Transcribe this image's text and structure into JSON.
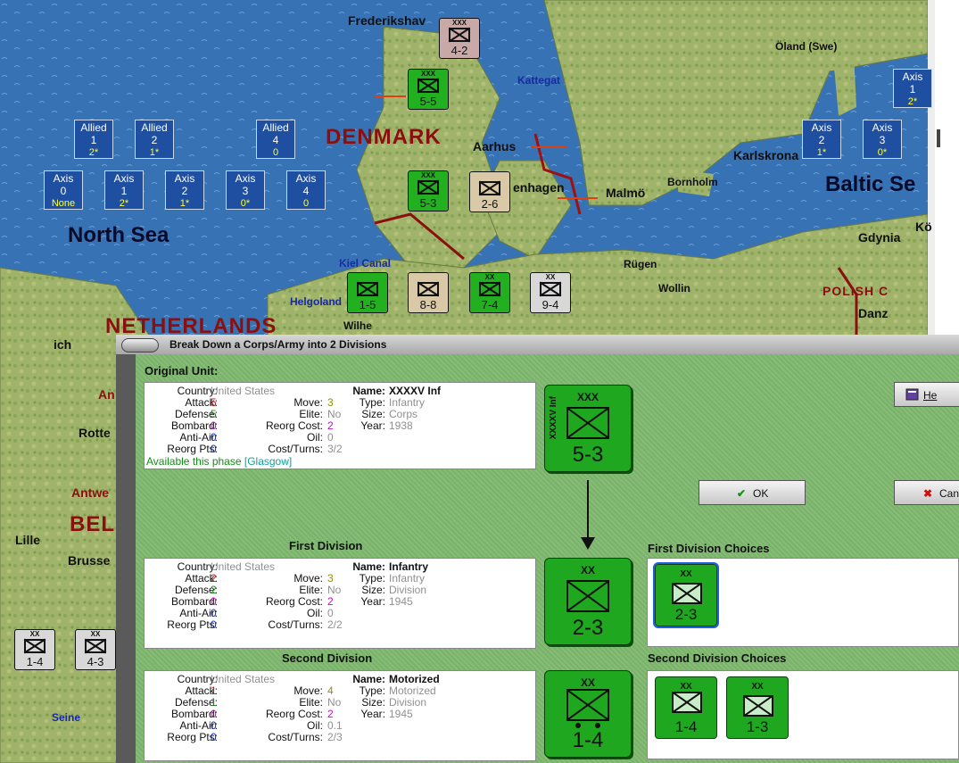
{
  "map": {
    "countries": [
      "DENMARK",
      "NETHERLANDS",
      "BEL",
      "POLISH C"
    ],
    "seas": [
      "North Sea",
      "Baltic Se"
    ],
    "sea_labels": [
      "Kattegat",
      "Helgoland",
      "Kiel Canal"
    ],
    "cities": [
      "Frederikshav",
      "Aarhus",
      "enhagen",
      "Malmö",
      "Karlskrona",
      "Bornholm",
      "Öland (Swe)",
      "Gdynia",
      "Rügen",
      "Wollin",
      "Danz",
      "Lille",
      "Brusse",
      "Rotte",
      "Antwe",
      "An",
      "ich",
      "Wilhe",
      "Seine",
      "Kö"
    ],
    "allied_reserve": [
      {
        "label": "Allied",
        "num": "1",
        "sub": "2*"
      },
      {
        "label": "Allied",
        "num": "2",
        "sub": "1*"
      },
      {
        "label": "Allied",
        "num": "4",
        "sub": "0"
      }
    ],
    "axis_reserve": [
      {
        "label": "Axis",
        "num": "0",
        "sub": "None"
      },
      {
        "label": "Axis",
        "num": "1",
        "sub": "2*"
      },
      {
        "label": "Axis",
        "num": "2",
        "sub": "1*"
      },
      {
        "label": "Axis",
        "num": "3",
        "sub": "0*"
      },
      {
        "label": "Axis",
        "num": "4",
        "sub": "0"
      }
    ],
    "axis_reserve_east": [
      {
        "label": "Axis",
        "num": "1",
        "sub": "2*"
      },
      {
        "label": "Axis",
        "num": "2",
        "sub": "1*"
      },
      {
        "label": "Axis",
        "num": "3",
        "sub": "0*"
      }
    ],
    "map_units": [
      {
        "size": "XXX",
        "str": "4-2",
        "style": "r"
      },
      {
        "size": "XXX",
        "str": "5-5",
        "style": "g"
      },
      {
        "size": "XXX",
        "str": "5-3",
        "style": "g"
      },
      {
        "size": "",
        "str": "2-6",
        "style": "t"
      },
      {
        "size": "",
        "str": "1-5",
        "style": "g"
      },
      {
        "size": "",
        "str": "8-8",
        "style": "t"
      },
      {
        "size": "XX",
        "str": "7-4",
        "style": "g"
      },
      {
        "size": "XX",
        "str": "9-4",
        "style": "w"
      },
      {
        "size": "XX",
        "str": "1-4",
        "style": "w"
      },
      {
        "size": "XX",
        "str": "4-3",
        "style": "w"
      }
    ]
  },
  "dialog": {
    "title": "Break Down a Corps/Army into 2 Divisions",
    "original_header": "Original Unit:",
    "first_header": "First Division",
    "second_header": "Second Division",
    "first_choices_header": "First Division Choices",
    "second_choices_header": "Second Division Choices",
    "labels": {
      "country": "Country:",
      "attack": "Attack:",
      "defense": "Defense:",
      "bombard": "Bombard:",
      "antiair": "Anti-Air:",
      "reorg_pts": "Reorg Pts:",
      "move": "Move:",
      "elite": "Elite:",
      "reorg_cost": "Reorg Cost:",
      "oil": "Oil:",
      "cost_turns": "Cost/Turns:",
      "name": "Name:",
      "type": "Type:",
      "size": "Size:",
      "year": "Year:"
    },
    "original": {
      "country": "United States",
      "attack": "5",
      "defense": "5",
      "bombard": "0",
      "antiair": "0",
      "reorg_pts": "0",
      "move": "3",
      "elite": "No",
      "reorg_cost": "2",
      "oil": "0",
      "cost_turns": "3/2",
      "name": "XXXXV Inf",
      "type": "Infantry",
      "size": "Corps",
      "year": "1938",
      "available": "Available this phase",
      "location": "[Glasgow]",
      "counter_size": "XXX",
      "counter_name": "XXXXV Inf",
      "counter_str": "5-3"
    },
    "first": {
      "country": "United States",
      "attack": "2",
      "defense": "2",
      "bombard": "0",
      "antiair": "0",
      "reorg_pts": "0",
      "move": "3",
      "elite": "No",
      "reorg_cost": "2",
      "oil": "0",
      "cost_turns": "2/2",
      "name": "Infantry",
      "type": "Infantry",
      "size": "Division",
      "year": "1945",
      "counter_size": "XX",
      "counter_str": "2-3"
    },
    "second": {
      "country": "United States",
      "attack": "1",
      "defense": "1",
      "bombard": "0",
      "antiair": "0",
      "reorg_pts": "0",
      "move": "4",
      "elite": "No",
      "reorg_cost": "2",
      "oil": "0.1",
      "cost_turns": "2/3",
      "name": "Motorized",
      "type": "Motorized",
      "size": "Division",
      "year": "1945",
      "counter_size": "XX",
      "counter_str": "1-4"
    },
    "first_choices": [
      {
        "size": "XX",
        "str": "2-3"
      }
    ],
    "second_choices": [
      {
        "size": "XX",
        "str": "1-4"
      },
      {
        "size": "XX",
        "str": "1-3"
      }
    ],
    "buttons": {
      "help": "He",
      "ok": "OK",
      "cancel": "Can"
    }
  }
}
